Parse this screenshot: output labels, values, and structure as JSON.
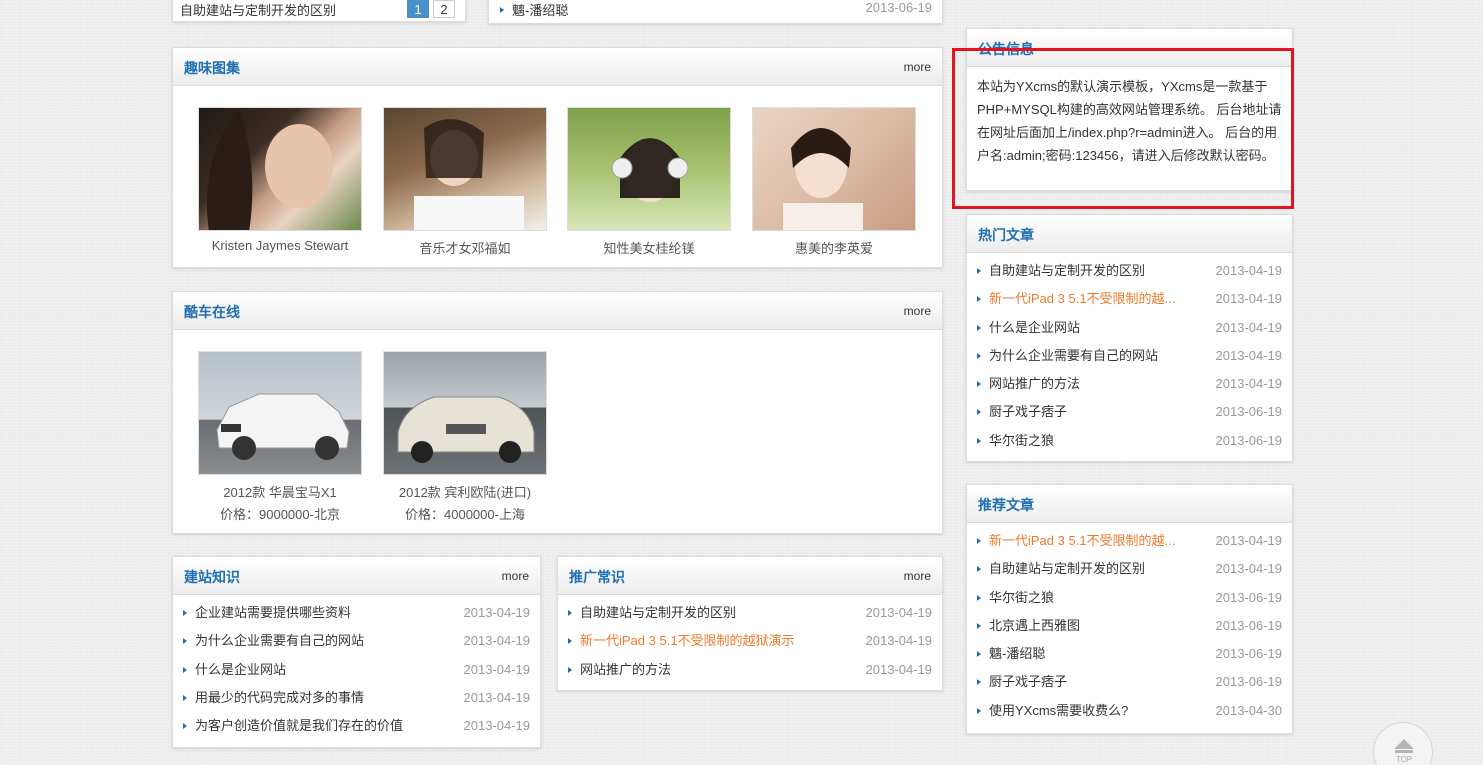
{
  "top_fragment": {
    "left_item": "自助建站与定制开发的区别",
    "pages": [
      "1",
      "2"
    ],
    "right_item": "魑-潘绍聪",
    "right_date": "2013-06-19"
  },
  "gallery": {
    "title": "趣味图集",
    "more": "more",
    "items": [
      {
        "caption": "Kristen Jaymes Stewart"
      },
      {
        "caption": "音乐才女邓福如"
      },
      {
        "caption": "知性美女桂纶镁"
      },
      {
        "caption": "惠美的李英爱"
      }
    ]
  },
  "cars": {
    "title": "酷车在线",
    "more": "more",
    "items": [
      {
        "name": "2012款 华晨宝马X1",
        "price": "价格：9000000-北京"
      },
      {
        "name": "2012款 宾利欧陆(进口)",
        "price": "价格：4000000-上海"
      }
    ]
  },
  "build": {
    "title": "建站知识",
    "more": "more",
    "items": [
      {
        "title": "企业建站需要提供哪些资料",
        "date": "2013-04-19"
      },
      {
        "title": "为什么企业需要有自己的网站",
        "date": "2013-04-19"
      },
      {
        "title": "什么是企业网站",
        "date": "2013-04-19"
      },
      {
        "title": "用最少的代码完成对多的事情",
        "date": "2013-04-19"
      },
      {
        "title": "为客户创造价值就是我们存在的价值",
        "date": "2013-04-19"
      }
    ]
  },
  "promo": {
    "title": "推广常识",
    "more": "more",
    "items": [
      {
        "title": "自助建站与定制开发的区别",
        "date": "2013-04-19"
      },
      {
        "title": "新一代iPad 3 5.1不受限制的越狱演示",
        "date": "2013-04-19"
      },
      {
        "title": "网站推广的方法",
        "date": "2013-04-19"
      }
    ]
  },
  "notice": {
    "title": "公告信息",
    "text": "本站为YXcms的默认演示模板，YXcms是一款基于PHP+MYSQL构建的高效网站管理系统。 后台地址请在网址后面加上/index.php?r=admin进入。 后台的用户名:admin;密码:123456，请进入后修改默认密码。"
  },
  "hot": {
    "title": "热门文章",
    "items": [
      {
        "title": "自助建站与定制开发的区别",
        "date": "2013-04-19"
      },
      {
        "title": "新一代iPad 3 5.1不受限制的越...",
        "date": "2013-04-19"
      },
      {
        "title": "什么是企业网站",
        "date": "2013-04-19"
      },
      {
        "title": "为什么企业需要有自己的网站",
        "date": "2013-04-19"
      },
      {
        "title": "网站推广的方法",
        "date": "2013-04-19"
      },
      {
        "title": "厨子戏子痞子",
        "date": "2013-06-19"
      },
      {
        "title": "华尔街之狼",
        "date": "2013-06-19"
      }
    ]
  },
  "recommend": {
    "title": "推荐文章",
    "items": [
      {
        "title": "新一代iPad 3 5.1不受限制的越...",
        "date": "2013-04-19"
      },
      {
        "title": "自助建站与定制开发的区别",
        "date": "2013-04-19"
      },
      {
        "title": "华尔街之狼",
        "date": "2013-06-19"
      },
      {
        "title": "北京遇上西雅图",
        "date": "2013-06-19"
      },
      {
        "title": "魑-潘绍聪",
        "date": "2013-06-19"
      },
      {
        "title": "厨子戏子痞子",
        "date": "2013-06-19"
      },
      {
        "title": "使用YXcms需要收费么?",
        "date": "2013-04-30"
      }
    ]
  },
  "top_button": {
    "label": "TOP"
  },
  "colors": {
    "title_blue": "#1f6fb2",
    "highlight_orange": "#f07a2b",
    "annotation_red": "#e3141f"
  }
}
